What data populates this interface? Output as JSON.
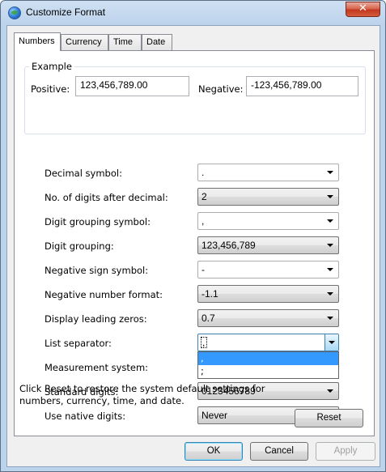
{
  "window": {
    "title": "Customize Format",
    "close_label": "✕"
  },
  "tabs": [
    {
      "label": "Numbers",
      "active": true
    },
    {
      "label": "Currency",
      "active": false
    },
    {
      "label": "Time",
      "active": false
    },
    {
      "label": "Date",
      "active": false
    }
  ],
  "example": {
    "group_label": "Example",
    "positive_label": "Positive:",
    "positive_value": "123,456,789.00",
    "negative_label": "Negative:",
    "negative_value": "-123,456,789.00"
  },
  "settings": [
    {
      "label": "Decimal symbol:",
      "value": "."
    },
    {
      "label": "No. of digits after decimal:",
      "value": "2"
    },
    {
      "label": "Digit grouping symbol:",
      "value": ","
    },
    {
      "label": "Digit grouping:",
      "value": "123,456,789"
    },
    {
      "label": "Negative sign symbol:",
      "value": "-"
    },
    {
      "label": "Negative number format:",
      "value": "-1.1"
    },
    {
      "label": "Display leading zeros:",
      "value": "0.7"
    },
    {
      "label": "List separator:",
      "value": ","
    },
    {
      "label": "Measurement system:",
      "value": ""
    },
    {
      "label": "Standard digits:",
      "value": "0123456789"
    },
    {
      "label": "Use native digits:",
      "value": "Never"
    }
  ],
  "list_separator_options": [
    ",",
    ";"
  ],
  "reset_note": "Click Reset to restore the system default settings for numbers, currency, time, and date.",
  "buttons": {
    "reset": "Reset",
    "ok": "OK",
    "cancel": "Cancel",
    "apply": "Apply"
  },
  "colors": {
    "selection": "#3399ff",
    "focus_border": "#3c7fb1"
  }
}
